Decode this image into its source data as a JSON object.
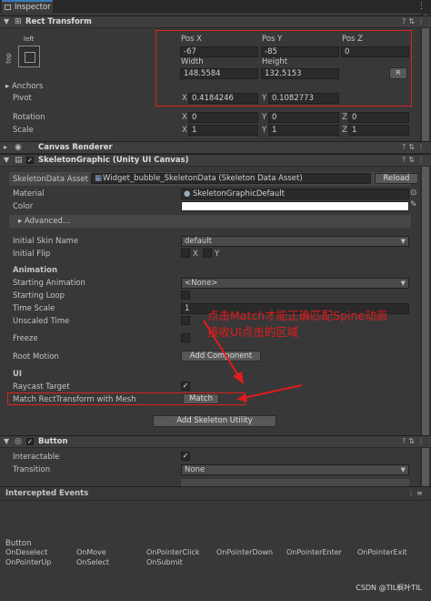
{
  "tab": {
    "label": "Inspector"
  },
  "rect_transform": {
    "title": "Rect Transform",
    "anchor_preset_h": "left",
    "anchor_preset_v": "top",
    "pos_x_label": "Pos X",
    "pos_y_label": "Pos Y",
    "pos_z_label": "Pos Z",
    "pos_x": "-67",
    "pos_y": "-85",
    "pos_z": "0",
    "width_label": "Width",
    "height_label": "Height",
    "width": "148.5584",
    "height": "132.5153",
    "raw_button": "R",
    "anchors_label": "Anchors",
    "pivot_label": "Pivot",
    "pivot_x": "0.4184246",
    "pivot_y": "0.1082773",
    "rotation_label": "Rotation",
    "rotation_x": "0",
    "rotation_y": "0",
    "rotation_z": "0",
    "scale_label": "Scale",
    "scale_x": "1",
    "scale_y": "1",
    "scale_z": "1",
    "axis_x": "X",
    "axis_y": "Y",
    "axis_z": "Z"
  },
  "canvas_renderer": {
    "title": "Canvas Renderer"
  },
  "skeleton_graphic": {
    "title": "SkeletonGraphic (Unity UI Canvas)",
    "asset_label": "SkeletonData Asset",
    "asset_value": "Widget_bubble_SkeletonData (Skeleton Data Asset)",
    "reload_button": "Reload",
    "material_label": "Material",
    "material_value": "SkeletonGraphicDefault",
    "color_label": "Color",
    "advanced_label": "Advanced...",
    "initial_skin_label": "Initial Skin Name",
    "initial_skin_value": "default",
    "initial_flip_label": "Initial Flip",
    "flip_x": "X",
    "flip_y": "Y",
    "animation_header": "Animation",
    "starting_animation_label": "Starting Animation",
    "starting_animation_value": "<None>",
    "starting_loop_label": "Starting Loop",
    "time_scale_label": "Time Scale",
    "time_scale_value": "1",
    "unscaled_time_label": "Unscaled Time",
    "freeze_label": "Freeze",
    "root_motion_label": "Root Motion",
    "add_component_button": "Add Component",
    "ui_header": "UI",
    "raycast_label": "Raycast Target",
    "match_label": "Match RectTransform with Mesh",
    "match_button": "Match",
    "add_skeleton_utility_button": "Add Skeleton Utility"
  },
  "annotation": {
    "line1": "点击Match才能正确匹配Spine动画",
    "line2": "接收UI点击的区域"
  },
  "button_component": {
    "title": "Button",
    "interactable_label": "Interactable",
    "transition_label": "Transition",
    "transition_value": "None"
  },
  "intercepted": {
    "title": "Intercepted Events",
    "group": "Button",
    "events_row1": [
      "OnDeselect",
      "OnMove",
      "OnPointerClick",
      "OnPointerDown",
      "OnPointerEnter",
      "OnPointerExit"
    ],
    "events_row2": [
      "OnPointerUp",
      "OnSelect",
      "OnSubmit"
    ]
  },
  "watermark": "CSDN @TIL枫叶TIL",
  "colors": {
    "annotation": "#e21b1b",
    "tab_accent": "#3a79bb"
  }
}
